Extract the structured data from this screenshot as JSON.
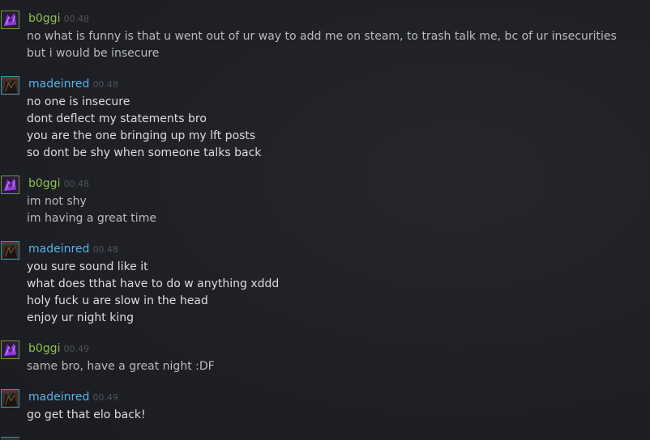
{
  "colors": {
    "background": "#1f2026",
    "boggi_name": "#8ebf4a",
    "madeinred_name": "#55b5e8",
    "timestamp": "#4f5259",
    "text_boggi": "#b9bbbf",
    "text_madeinred": "#dcdde0"
  },
  "messages": [
    {
      "sender": "b0ggi",
      "time": "00.48",
      "avatar_icon": "purple-character-avatar-icon",
      "lines": [
        "no what is funny is that u went out of ur way to add me on steam, to trash talk me, bc of ur insecurities",
        "but i would be insecure"
      ]
    },
    {
      "sender": "madeinred",
      "time": "00.48",
      "avatar_icon": "dark-character-avatar-icon",
      "lines": [
        "no one is insecure",
        "dont deflect my statements bro",
        "you are the one bringing up my lft posts",
        "so dont be shy when someone talks back"
      ]
    },
    {
      "sender": "b0ggi",
      "time": "00.48",
      "avatar_icon": "purple-character-avatar-icon",
      "lines": [
        "im not shy",
        "im having a great time"
      ]
    },
    {
      "sender": "madeinred",
      "time": "00.48",
      "avatar_icon": "dark-character-avatar-icon",
      "lines": [
        "you sure sound like it",
        "what does tthat have to do w anything xddd",
        "holy fuck u are slow in the head",
        "enjoy ur night king"
      ]
    },
    {
      "sender": "b0ggi",
      "time": "00.49",
      "avatar_icon": "purple-character-avatar-icon",
      "lines": [
        "same bro, have a great night :DF"
      ]
    },
    {
      "sender": "madeinred",
      "time": "00.49",
      "avatar_icon": "dark-character-avatar-icon",
      "lines": [
        "go get that elo back!"
      ]
    }
  ]
}
